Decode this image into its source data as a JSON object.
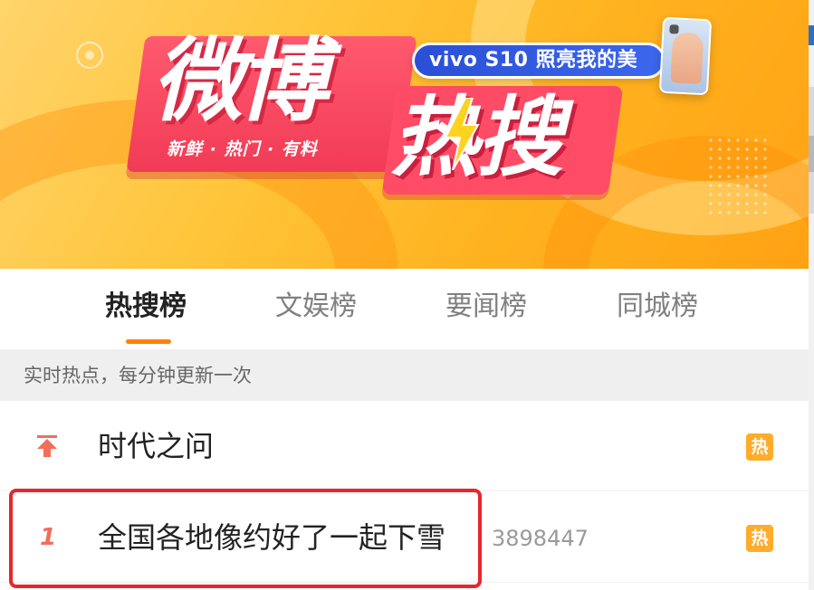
{
  "banner": {
    "logo_line1": "微博",
    "logo_line2": "热搜",
    "slogan": "新鲜 · 热门 · 有料",
    "ad_text": "vivo S10 照亮我的美",
    "colors": {
      "background": "#ffb21f",
      "logo_red": "#f23b56",
      "ad_blue": "#2a4fd6"
    }
  },
  "tabs": {
    "items": [
      {
        "label": "热搜榜",
        "active": true
      },
      {
        "label": "文娱榜",
        "active": false
      },
      {
        "label": "要闻榜",
        "active": false
      },
      {
        "label": "同城榜",
        "active": false
      }
    ],
    "accent_color": "#ff8200"
  },
  "info_bar": {
    "text": "实时热点，每分钟更新一次"
  },
  "list": {
    "items": [
      {
        "rank_icon": "pin-top-icon",
        "title": "时代之问",
        "count": "",
        "badge": "热"
      },
      {
        "rank": "1",
        "title": "全国各地像约好了一起下雪",
        "count": "3898447",
        "badge": "热"
      }
    ],
    "highlighted_index": 1,
    "highlight_color": "#e8262b"
  }
}
